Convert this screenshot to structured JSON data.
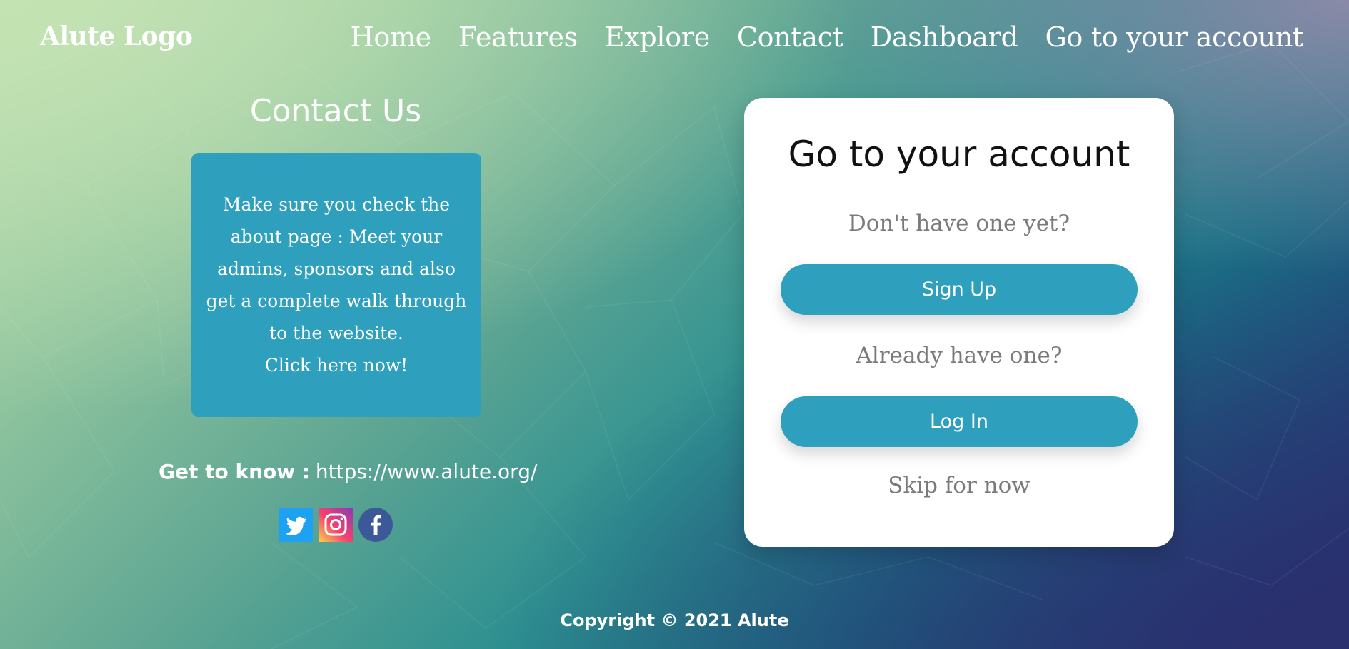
{
  "header": {
    "logo": "Alute Logo",
    "nav": [
      "Home",
      "Features",
      "Explore",
      "Contact",
      "Dashboard",
      "Go to your account"
    ]
  },
  "contact": {
    "title": "Contact Us",
    "info_text": "Make sure you check the about page : Meet your admins, sponsors and also get a complete walk through to the website.",
    "info_cta": "Click here now!",
    "know_label": "Get to know :",
    "know_url": "https://www.alute.org/",
    "social": [
      "twitter-icon",
      "instagram-icon",
      "facebook-icon"
    ]
  },
  "account": {
    "title": "Go to your account",
    "signup_prompt": "Don't have one yet?",
    "signup_button": "Sign Up",
    "login_prompt": "Already have one?",
    "login_button": "Log In",
    "skip": "Skip for now"
  },
  "footer": {
    "copyright": "Copyright © 2021 Alute"
  },
  "colors": {
    "accent": "#2f9fbe",
    "twitter": "#1da1f2",
    "facebook": "#3b5998",
    "muted_text": "#7a7a7a"
  }
}
